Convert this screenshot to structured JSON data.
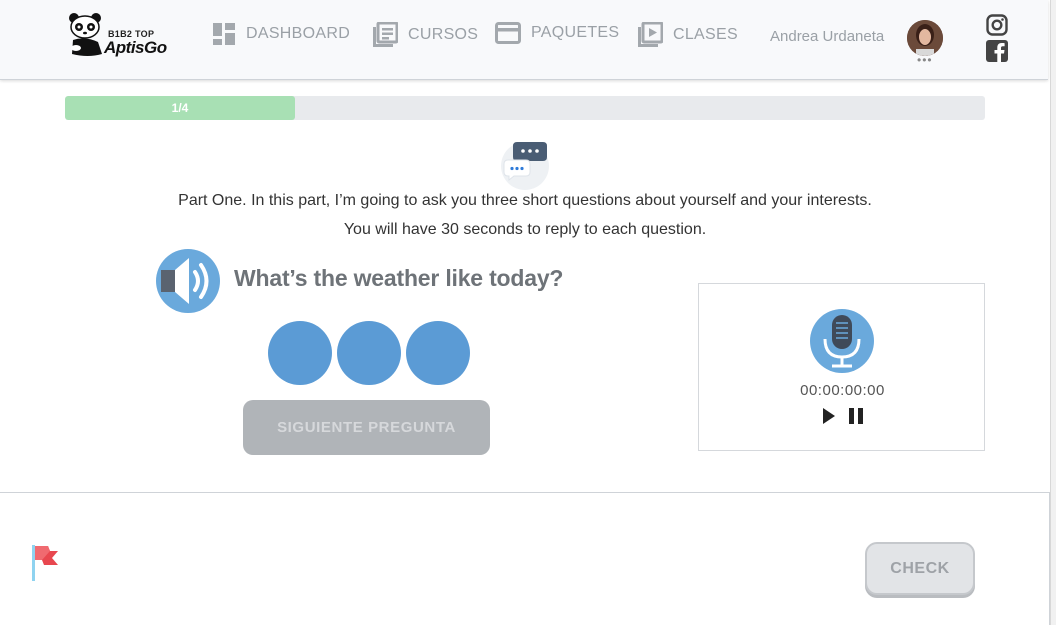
{
  "header": {
    "logo": {
      "tagline": "B1B2 TOP",
      "brand": "AptisGo"
    },
    "nav": [
      {
        "label": "DASHBOARD",
        "icon": "dashboard-icon"
      },
      {
        "label": "CURSOS",
        "icon": "courses-icon"
      },
      {
        "label": "PAQUETES",
        "icon": "card-icon"
      },
      {
        "label": "CLASES",
        "icon": "video-library-icon"
      }
    ],
    "user": {
      "name": "Andrea Urdaneta",
      "menu_dots": "•••"
    },
    "social": [
      "instagram-icon",
      "facebook-icon"
    ]
  },
  "progress": {
    "label": "1/4",
    "value": 0.25
  },
  "instructions": {
    "line1": "Part One. In this part, I’m going to ask you three short questions about yourself and your interests.",
    "line2": "You will have 30 seconds to reply to each question."
  },
  "question": {
    "text": "What’s the weather like today?"
  },
  "next_button": {
    "label": "SIGUIENTE PREGUNTA"
  },
  "recorder": {
    "timer": "00:00:00:00"
  },
  "footer": {
    "check_label": "CHECK"
  },
  "colors": {
    "accent_blue": "#5b9bd5",
    "progress_green": "#a8e0b4",
    "nav_gray": "#9aa0a6"
  }
}
